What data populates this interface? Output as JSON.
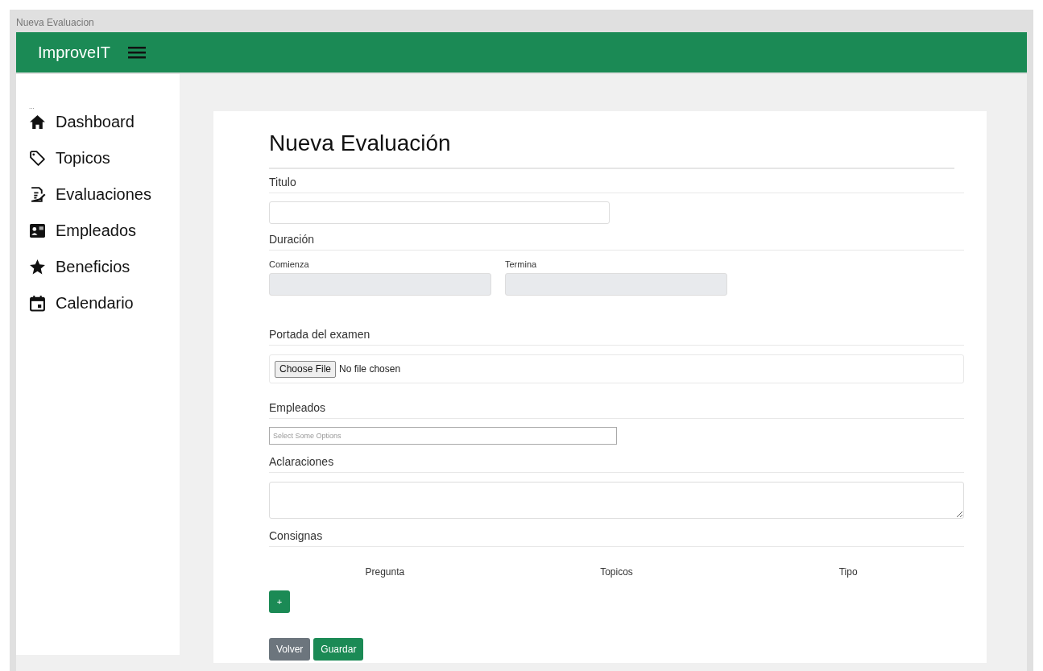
{
  "window": {
    "title": "Nueva Evaluacion"
  },
  "navbar": {
    "brand": "ImproveIT"
  },
  "sidebar": {
    "marker": "...",
    "items": [
      {
        "label": "Dashboard",
        "selected": false
      },
      {
        "label": "Topicos",
        "selected": false
      },
      {
        "label": "Evaluaciones",
        "selected": false
      },
      {
        "label": "Empleados",
        "selected": false
      },
      {
        "label": "Beneficios",
        "selected": false
      },
      {
        "label": "Calendario",
        "selected": false
      }
    ]
  },
  "form": {
    "title": "Nueva Evaluación",
    "titulo": {
      "label": "Titulo"
    },
    "duracion": {
      "label": "Duración",
      "start_label": "Comienza",
      "end_label": "Termina"
    },
    "portada": {
      "label": "Portada del examen",
      "button": "Choose File",
      "status": "No file chosen"
    },
    "empleados": {
      "label": "Empleados",
      "placeholder": "Select Some Options"
    },
    "aclaraciones": {
      "label": "Aclaraciones"
    },
    "consignas": {
      "label": "Consignas",
      "columns": [
        "Pregunta",
        "Topicos",
        "Tipo"
      ],
      "add_button": "+"
    },
    "buttons": [
      {
        "label": "Volver",
        "kind": "secondary"
      },
      {
        "label": "Guardar",
        "kind": "primary"
      }
    ]
  }
}
